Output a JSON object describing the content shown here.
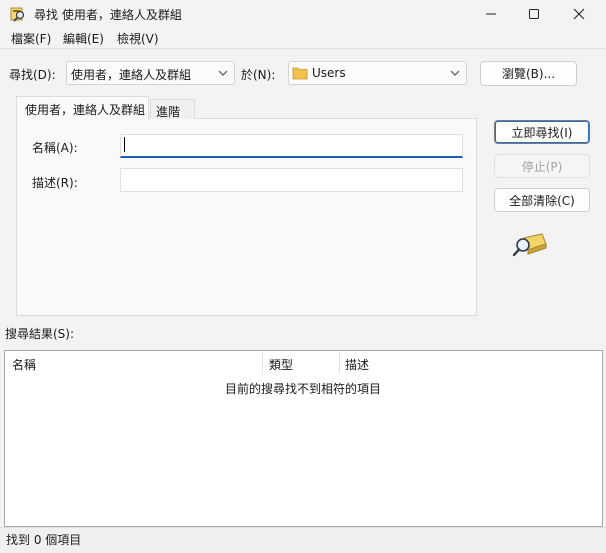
{
  "window": {
    "title": "尋找 使用者，連絡人及群組",
    "icon": "directory-search-icon"
  },
  "menu": {
    "file": "檔案(F)",
    "edit": "編輯(E)",
    "view": "檢視(V)"
  },
  "search": {
    "find_label": "尋找(D):",
    "find_value": "使用者，連絡人及群組",
    "in_label": "於(N):",
    "in_value": "Users",
    "browse_label": "瀏覽(B)..."
  },
  "tabs": [
    {
      "label": "使用者，連絡人及群組",
      "selected": true
    },
    {
      "label": "進階",
      "selected": false
    }
  ],
  "fields": {
    "name_label": "名稱(A):",
    "name_value": "",
    "description_label": "描述(R):",
    "description_value": ""
  },
  "actions": {
    "find_now": "立即尋找(I)",
    "stop": "停止(P)",
    "clear_all": "全部清除(C)"
  },
  "results": {
    "label": "搜尋結果(S):",
    "columns": [
      "名稱",
      "類型",
      "描述"
    ],
    "empty_message": "目前的搜尋找不到相符的項目"
  },
  "status": {
    "text": "找到 0 個項目"
  },
  "colors": {
    "accent": "#1f5fb3",
    "window_bg": "#f3f3f3",
    "folder": "#f2c14e"
  }
}
